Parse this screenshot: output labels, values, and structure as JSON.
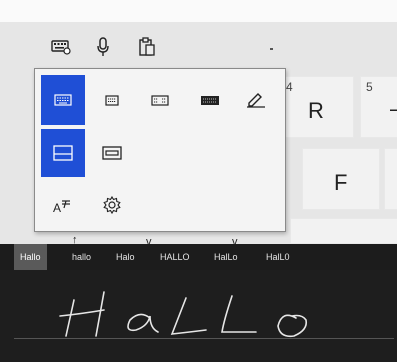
{
  "toolbar": {
    "items": [
      {
        "icon": "keyboard-settings-icon"
      },
      {
        "icon": "microphone-icon"
      },
      {
        "icon": "clipboard-icon"
      }
    ]
  },
  "keyboard": {
    "keys": [
      {
        "number": "4",
        "letter": "R"
      },
      {
        "number": "5",
        "letter": ""
      },
      {
        "number": "",
        "letter": "F"
      }
    ]
  },
  "layout_flyout": {
    "rows": [
      [
        "keyboard-default-icon",
        "keyboard-small-icon",
        "keyboard-split-icon",
        "keyboard-full-icon",
        "handwriting-pen-icon"
      ],
      [
        "docked-layout-icon",
        "undocked-layout-icon"
      ],
      [
        "text-suggestions-icon",
        "gear-icon"
      ]
    ],
    "selected": [
      "keyboard-default-icon",
      "docked-layout-icon"
    ],
    "accent": "#1f4fd6"
  },
  "candidates": [
    "Hallo",
    "hallo",
    "Halo",
    "HALLO",
    "HalLo",
    "HalL0"
  ],
  "handwriting": {
    "ink_color": "#e6e6e6",
    "background": "#1e1e1e"
  }
}
